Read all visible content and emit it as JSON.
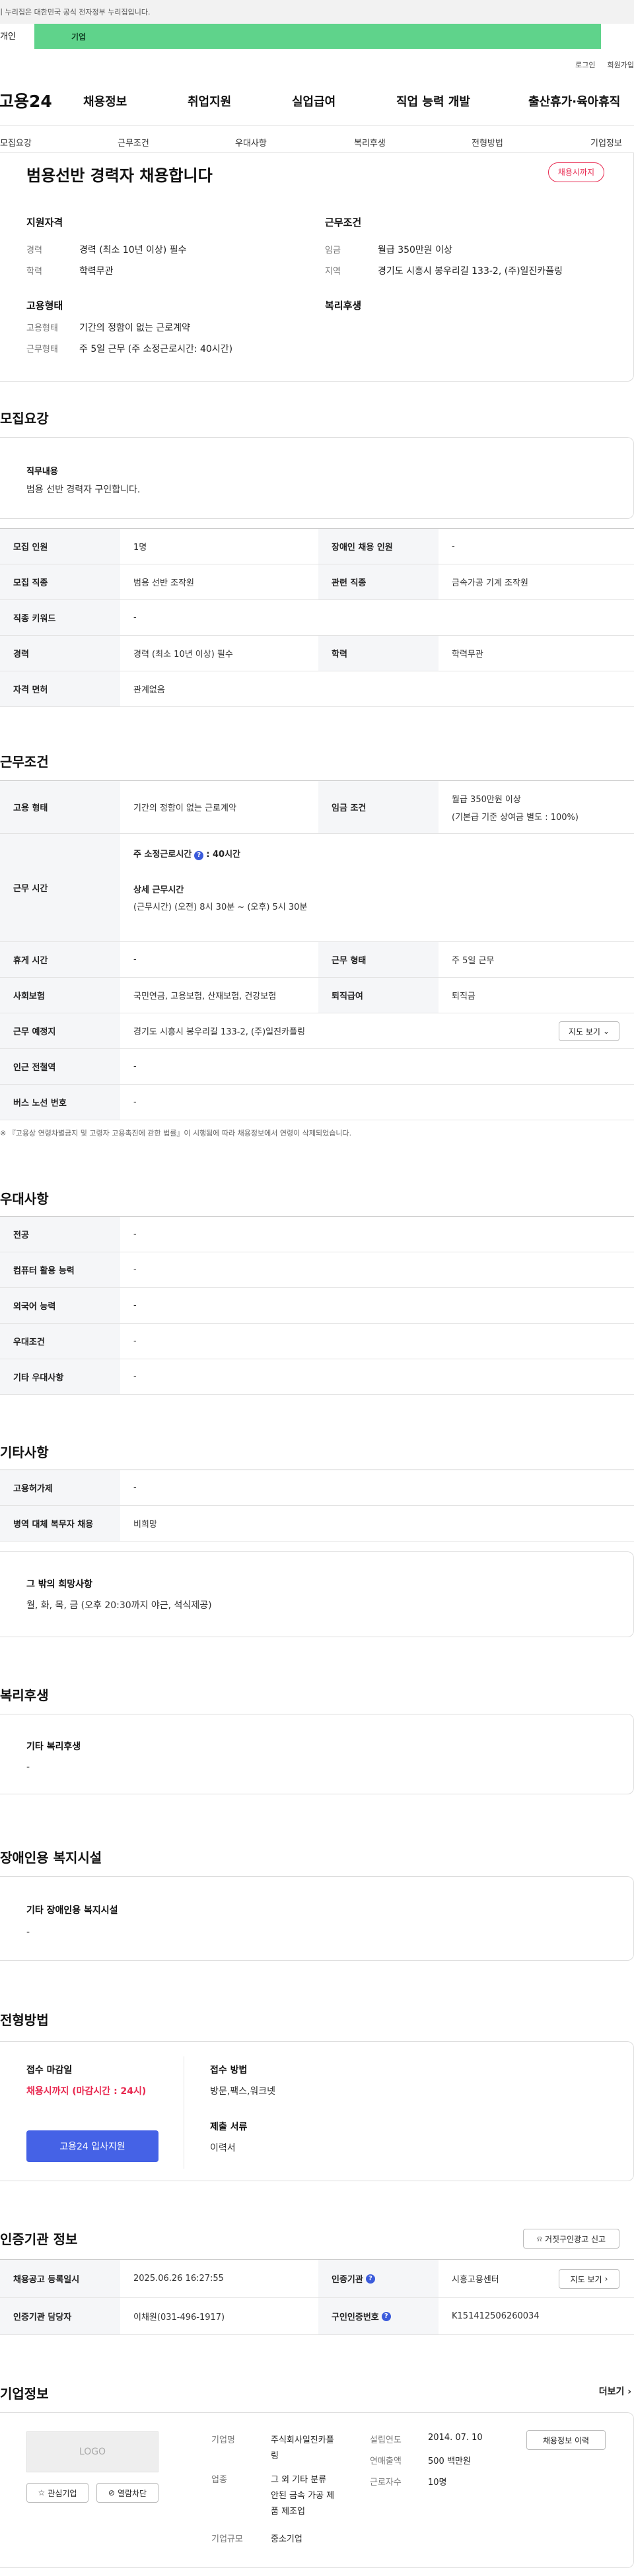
{
  "gov_banner": "이 누리집은 대한민국 공식 전자정부 누리집입니다.",
  "audience": {
    "person": "개인",
    "company": "기업"
  },
  "util": {
    "login": "로그인",
    "join": "회원가입"
  },
  "gnb": {
    "logo": "고용24",
    "items": [
      "채용정보",
      "취업지원",
      "실업급여",
      "직업 능력 개발",
      "출산휴가·육아휴직"
    ]
  },
  "subnav": [
    "모집요강",
    "근무조건",
    "우대사항",
    "복리후생",
    "전형방법",
    "기업정보"
  ],
  "summary": {
    "title": "범용선반 경력자 채용합니다",
    "badge": "채용시까지",
    "qualification_head": "지원자격",
    "career_key": "경력",
    "career_val": "경력 (최소 10년 이상) 필수",
    "edu_key": "학력",
    "edu_val": "학력무관",
    "condition_head": "근무조건",
    "wage_key": "임금",
    "wage_val": "월급 350만원 이상",
    "region_key": "지역",
    "region_val": "경기도 시흥시 봉우리길 133-2, (주)일진카플링",
    "employ_head": "고용형태",
    "employ_key": "고용형태",
    "employ_val": "기간의 정함이 없는 근로계약",
    "work_key": "근무형태",
    "work_val": "주 5일 근무 (주 소정근로시간: 40시간)",
    "welfare_head": "복리후생"
  },
  "recruit": {
    "title": "모집요강",
    "duty_label": "직무내용",
    "duty_text": "범용 선반  경력자  구인합니다.",
    "rows": [
      {
        "k1": "모집 인원",
        "v1": "1명",
        "k2": "장애인 채용 인원",
        "v2": "-"
      },
      {
        "k1": "모집 직종",
        "v1": "범용 선반 조작원",
        "k2": "관련 직종",
        "v2": "금속가공 기계 조작원"
      },
      {
        "k1": "직종 키워드",
        "v1": "-"
      },
      {
        "k1": "경력",
        "v1": "경력 (최소 10년 이상) 필수",
        "k2": "학력",
        "v2": "학력무관"
      },
      {
        "k1": "자격 면허",
        "v1": "관계없음"
      }
    ]
  },
  "work": {
    "title": "근무조건",
    "r1": {
      "k1": "고용 형태",
      "v1": "기간의 정함이 없는 근로계약",
      "k2": "임금 조건",
      "v2a": "월급 350만원 이상",
      "v2b": "(기본급 기준 상여금 별도 : 100%)"
    },
    "r2": {
      "k1": "근무 시간",
      "weekly_label": "주 소정근로시간",
      "weekly_val": ": 40시간",
      "detail_label": "상세 근무시간",
      "detail_val": "(근무시간) (오전) 8시 30분 ~ (오후) 5시 30분"
    },
    "r3": {
      "k1": "휴게 시간",
      "v1": "-",
      "k2": "근무 형태",
      "v2": "주 5일 근무"
    },
    "r4": {
      "k1": "사회보험",
      "v1": "국민연금, 고용보험, 산재보험, 건강보험",
      "k2": "퇴직급여",
      "v2": "퇴직금"
    },
    "r5": {
      "k1": "근무 예정지",
      "v1": "경기도 시흥시 봉우리길 133-2, (주)일진카플링",
      "map_btn": "지도 보기"
    },
    "r6": {
      "k1": "인근 전철역",
      "v1": "-"
    },
    "r7": {
      "k1": "버스 노선 번호",
      "v1": "-"
    },
    "note": "※ 『고용상 연령차별금지 및 고령자 고용촉진에 관한 법률』이 시행됨에 따라 채용정보에서 연령이 삭제되었습니다."
  },
  "pref": {
    "title": "우대사항",
    "rows": [
      {
        "k": "전공",
        "v": "-"
      },
      {
        "k": "컴퓨터 활용 능력",
        "v": "-"
      },
      {
        "k": "외국어 능력",
        "v": "-"
      },
      {
        "k": "우대조건",
        "v": "-"
      },
      {
        "k": "기타 우대사항",
        "v": "-"
      }
    ]
  },
  "etc": {
    "title": "기타사항",
    "rows": [
      {
        "k": "고용허가제",
        "v": "-"
      },
      {
        "k": "병역 대체 복무자 채용",
        "v": "비희망"
      }
    ],
    "other_label": "그 밖의 희망사항",
    "other_text": "월, 화, 목, 금 (오후 20:30까지 야근, 석식제공)"
  },
  "welfare": {
    "title": "복리후생",
    "label": "기타 복리후생",
    "text": "-"
  },
  "disability": {
    "title": "장애인용 복지시설",
    "label": "기타 장애인용 복지시설",
    "text": "-"
  },
  "selection": {
    "title": "전형방법",
    "deadline_label": "접수 마감일",
    "deadline_val": "채용시까지 (마감시간 : 24시)",
    "method_label": "접수 방법",
    "method_val": "방문,팩스,워크넷",
    "docs_label": "제출 서류",
    "docs_val": "이력서",
    "apply_btn": "고용24 입사지원"
  },
  "agency": {
    "title": "인증기관 정보",
    "report_btn": "거짓구인광고 신고",
    "r1": {
      "k1": "채용공고 등록일시",
      "v1": "2025.06.26 16:27:55",
      "k2": "인증기관",
      "v2": "시흥고용센터",
      "map_btn": "지도 보기"
    },
    "r2": {
      "k1": "인증기관 담당자",
      "v1": "이채원(031-496-1917)",
      "k2": "구인인증번호",
      "v2": "K151412506260034"
    }
  },
  "company": {
    "title": "기업정보",
    "more": "더보기",
    "logo": "LOGO",
    "fav_btn": "관심기업",
    "block_btn": "열람차단",
    "name_key": "기업명",
    "name_val1": "주식회사일진카플",
    "name_val2": "링",
    "industry_key": "업종",
    "industry_val1": "그 외 기타 분류",
    "industry_val2": "안된 금속 가공 제",
    "industry_val3": "품 제조업",
    "scale_key": "기업규모",
    "scale_val": "중소기업",
    "founded_key": "설립연도",
    "founded_val": "2014. 07. 10",
    "sales_key": "연매출액",
    "sales_val": "500 백만원",
    "emp_key": "근로자수",
    "emp_val": "10명",
    "jobs_btn": "채용정보 이력"
  }
}
